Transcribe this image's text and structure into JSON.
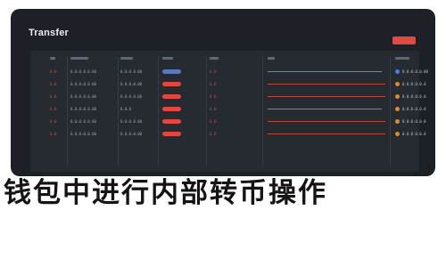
{
  "window": {
    "title": "Transfer"
  },
  "colors": {
    "background": "#1d2127",
    "panel": "#262b32",
    "accent_red": "#e2483f",
    "pill_blue": "#5a79b8",
    "dot_blue": "#4a82e0",
    "dot_orange": "#e08a2e",
    "hash_red": "#b8473f",
    "hash_gray": "#7c848e"
  },
  "table": {
    "rows": [
      {
        "idx": "0.0",
        "time": "0.0.0.0.0.00",
        "tag": "0.0.0.0.00",
        "pill": "blue",
        "amt": "0.0",
        "hash": "gray",
        "dot": "blue",
        "status": "0.0.0.0.0.00"
      },
      {
        "idx": "0.0",
        "time": "0.0.0.0.0.00",
        "tag": "0.0.0.0.00",
        "pill": "red",
        "amt": "0.0",
        "hash": "red",
        "dot": "orange",
        "status": "0.0.0.0.0.0"
      },
      {
        "idx": "0.0",
        "time": "0.0.0.0.0.00",
        "tag": "0.0.0.0.00",
        "pill": "red",
        "amt": "0.0",
        "hash": "red",
        "dot": "orange",
        "status": "0.0.0.0.0.0"
      },
      {
        "idx": "0.0",
        "time": "0.0.0.0.0.00",
        "tag": "0.0.0",
        "pill": "red",
        "amt": "0.0",
        "hash": "gray",
        "dot": "orange",
        "status": "0.0.0.0.0.0"
      },
      {
        "idx": "0.0",
        "time": "0.0.0.0.0.00",
        "tag": "0.0.0.0.00",
        "pill": "red",
        "amt": "0.0",
        "hash": "red",
        "dot": "orange",
        "status": "0.0.0.0.0.0"
      },
      {
        "idx": "0.0",
        "time": "0.0.0.0.0.00",
        "tag": "0.0.0.0.00",
        "pill": "red",
        "amt": "0.0",
        "hash": "red",
        "dot": "orange",
        "status": "0.0.0.0.0.0"
      }
    ]
  },
  "caption": "钱包中进行内部转币操作"
}
